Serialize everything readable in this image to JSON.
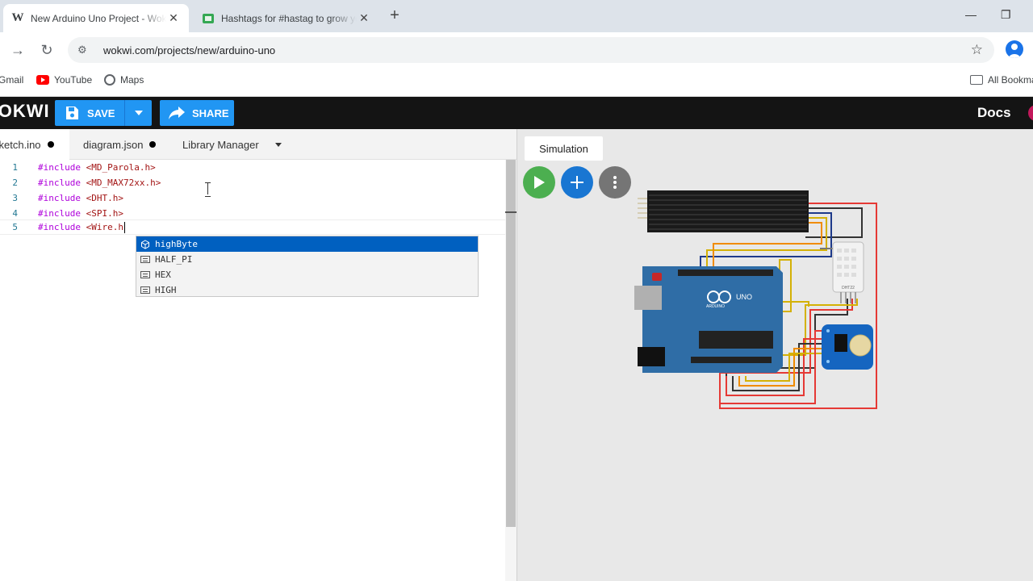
{
  "browser": {
    "tabs": [
      {
        "title": "New Arduino Uno Project - Wokwi",
        "favicon": "wokwi-icon"
      },
      {
        "title": "Hashtags for #hastag to grow your",
        "favicon": "hashtag-site-icon"
      }
    ],
    "url": "wokwi.com/projects/new/arduino-uno",
    "bookmarks": [
      {
        "label": "Gmail",
        "icon": "gmail-icon"
      },
      {
        "label": "YouTube",
        "icon": "youtube-icon"
      },
      {
        "label": "Maps",
        "icon": "maps-icon"
      }
    ],
    "all_bookmarks": "All Bookmarks"
  },
  "header": {
    "logo": "WOKWI",
    "save_label": "SAVE",
    "share_label": "SHARE",
    "docs_label": "Docs",
    "accent": "#2196f3"
  },
  "editor": {
    "tabs": [
      {
        "label": "sketch.ino",
        "modified": true
      },
      {
        "label": "diagram.json",
        "modified": true
      },
      {
        "label": "Library Manager"
      }
    ],
    "lines": [
      {
        "num": "1",
        "kw": "#include",
        "hdr": "<MD_Parola.h>"
      },
      {
        "num": "2",
        "kw": "#include",
        "hdr": "<MD_MAX72xx.h>"
      },
      {
        "num": "3",
        "kw": "#include",
        "hdr": "<DHT.h>"
      },
      {
        "num": "4",
        "kw": "#include",
        "hdr": "<SPI.h>"
      },
      {
        "num": "5",
        "kw": "#include",
        "hdr": "<Wire.h"
      }
    ],
    "suggestions": [
      {
        "label": "highByte",
        "kind": "function",
        "selected": true
      },
      {
        "label": "HALF_PI",
        "kind": "constant"
      },
      {
        "label": "HEX",
        "kind": "constant"
      },
      {
        "label": "HIGH",
        "kind": "constant"
      }
    ]
  },
  "simulation": {
    "tab_label": "Simulation",
    "board_label": "UNO",
    "board_brand": "ARDUINO",
    "sensor_label": "DHT22",
    "colors": {
      "play": "#4caf50",
      "add": "#1976d2",
      "more": "#757575",
      "board": "#2f6da6"
    }
  }
}
